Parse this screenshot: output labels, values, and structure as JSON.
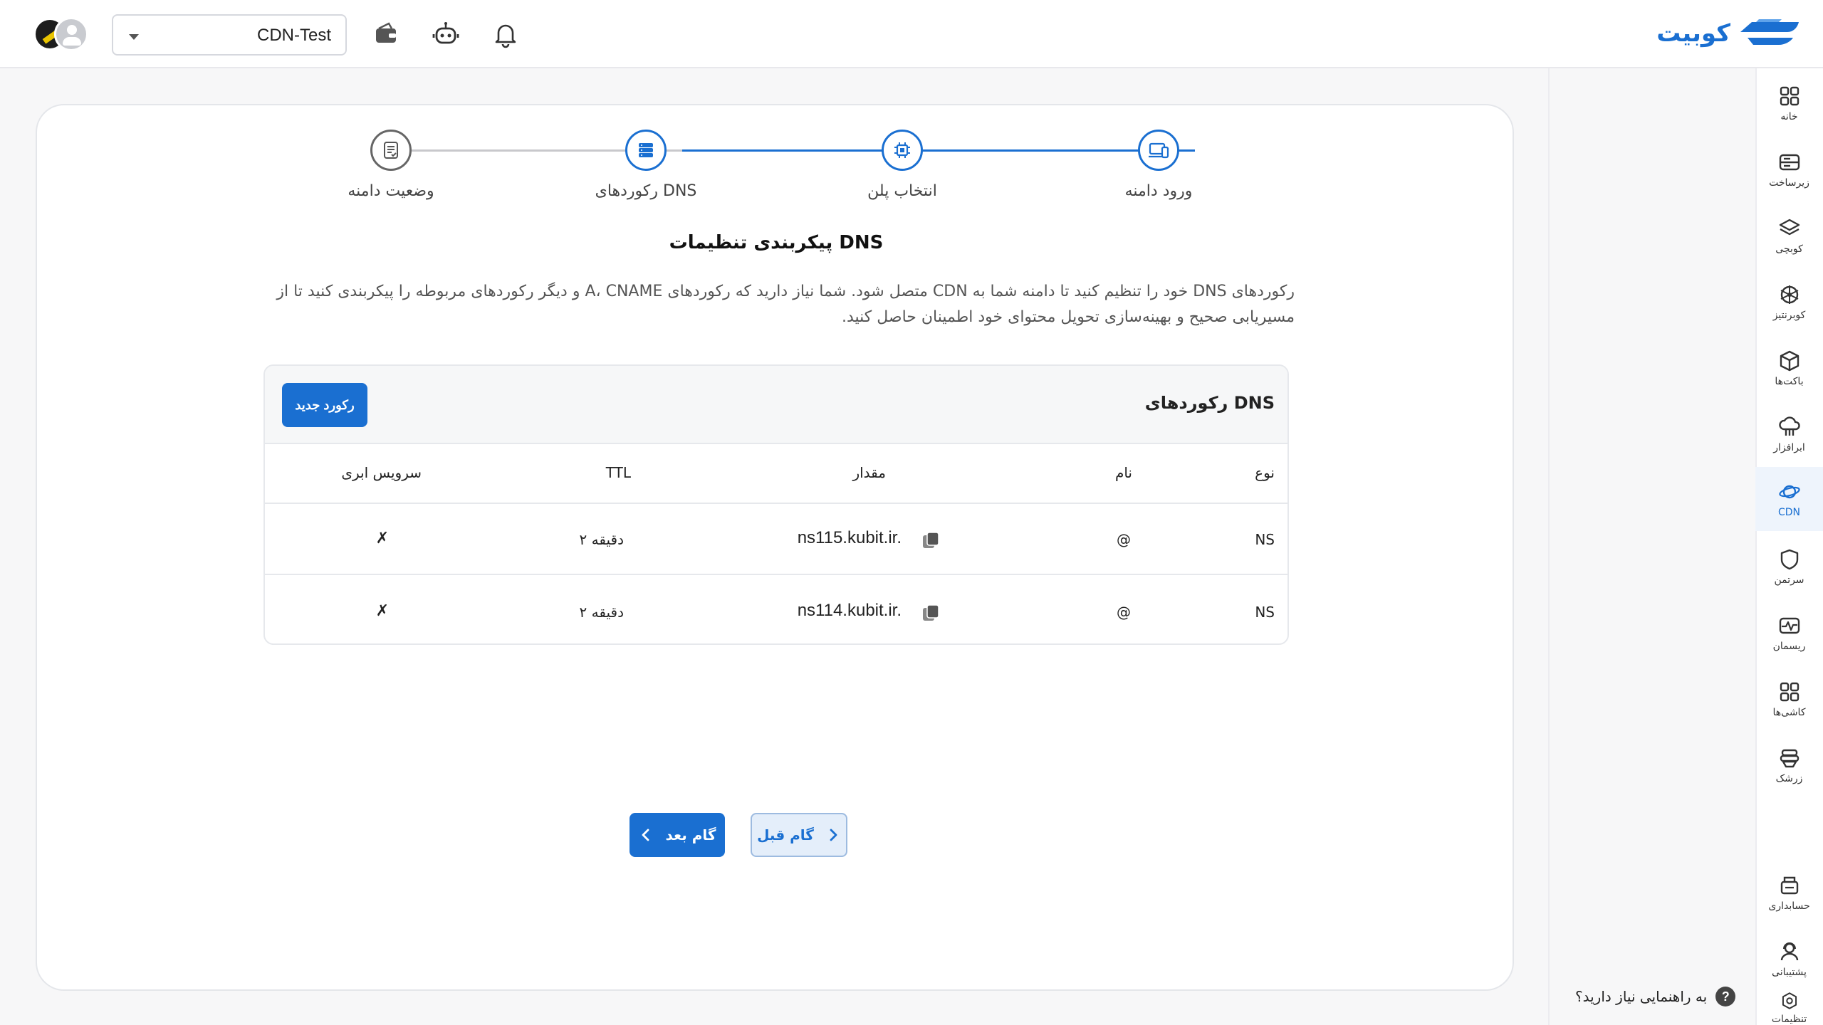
{
  "header": {
    "project_selected": "CDN-Test",
    "logo_text": "کوبیت",
    "icons": [
      "wallet-icon",
      "robot-icon",
      "bell-icon"
    ]
  },
  "sidebar": {
    "items": [
      {
        "label": "خانه",
        "icon": "grid-icon"
      },
      {
        "label": "زیرساخت",
        "icon": "server-icon"
      },
      {
        "label": "کوبچی",
        "icon": "layers-icon"
      },
      {
        "label": "کوبرنتیز",
        "icon": "helm-icon"
      },
      {
        "label": "باکت‌ها",
        "icon": "box-icon"
      },
      {
        "label": "ابرافزار",
        "icon": "cloud-app-icon"
      },
      {
        "label": "CDN",
        "icon": "planet-icon"
      },
      {
        "label": "سرتمن",
        "icon": "shield-icon"
      },
      {
        "label": "ریسمان",
        "icon": "pulse-icon"
      },
      {
        "label": "کاشی‌ها",
        "icon": "tiles-icon"
      },
      {
        "label": "زرشک",
        "icon": "stack-icon"
      },
      {
        "label": "حسابداری",
        "icon": "accounting-icon"
      },
      {
        "label": "پشتیبانی",
        "icon": "support-icon"
      },
      {
        "label": "تنظیمات",
        "icon": "settings-icon"
      }
    ],
    "active": "CDN",
    "accent": "#1a6fd1"
  },
  "help": {
    "text": "به راهنمایی نیاز دارید؟",
    "symbol": "?"
  },
  "stepper": {
    "steps": [
      {
        "label": "ورود دامنه",
        "state": "done"
      },
      {
        "label": "انتخاب پلن",
        "state": "done"
      },
      {
        "label": "رکوردهای DNS",
        "state": "current"
      },
      {
        "label": "وضعیت دامنه",
        "state": "pending"
      }
    ]
  },
  "main": {
    "title": "پیکربندی تنظیمات DNS",
    "description": "رکوردهای DNS خود را تنظیم کنید تا دامنه شما به CDN متصل شود. شما نیاز دارید که رکوردهای A، CNAME و دیگر رکوردهای مربوطه را پیکربندی کنید تا از مسیریابی صحیح و بهینه‌سازی تحویل محتوای خود اطمینان حاصل کنید."
  },
  "dns_table": {
    "title": "رکوردهای DNS",
    "new_record_label": "رکورد جدید",
    "columns": [
      "نوع",
      "نام",
      "مقدار",
      "TTL",
      "سرویس ابری"
    ],
    "rows": [
      {
        "type": "NS",
        "name": "@",
        "value": "ns115.kubit.ir.",
        "ttl": "۲ دقیقه",
        "cloud": "✗"
      },
      {
        "type": "NS",
        "name": "@",
        "value": "ns114.kubit.ir.",
        "ttl": "۲ دقیقه",
        "cloud": "✗"
      }
    ]
  },
  "nav": {
    "next_label": "گام بعد",
    "prev_label": "گام قبل"
  }
}
